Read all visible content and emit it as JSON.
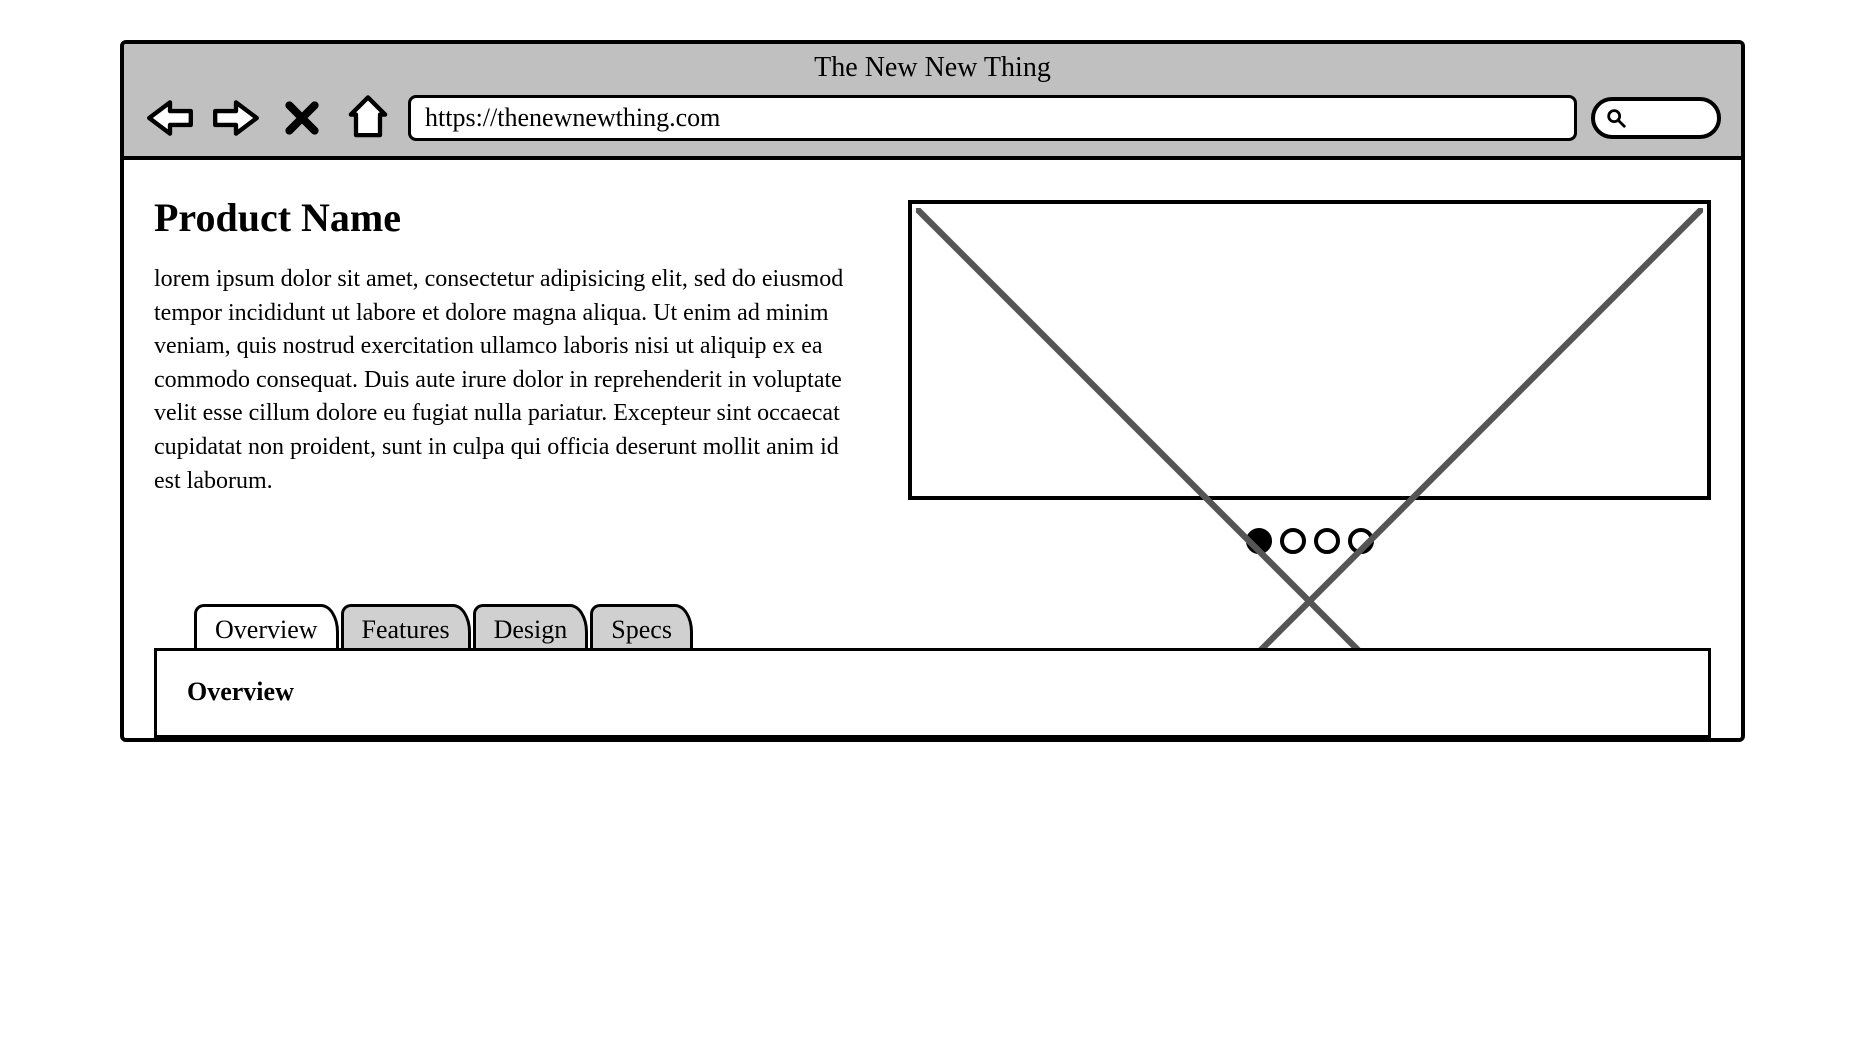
{
  "browser": {
    "title": "The New New Thing",
    "url": "https://thenewnewthing.com"
  },
  "product": {
    "name": "Product Name",
    "description": "lorem ipsum dolor sit amet, consectetur adipisicing elit, sed do eiusmod tempor incididunt ut labore et dolore magna aliqua. Ut enim ad minim veniam, quis nostrud exercitation ullamco laboris nisi ut aliquip ex ea commodo consequat. Duis aute irure dolor in reprehenderit in voluptate velit esse cillum dolore eu fugiat nulla pariatur. Excepteur sint occaecat cupidatat non proident, sunt in culpa qui officia deserunt mollit anim id est laborum."
  },
  "carousel": {
    "dot_count": 4,
    "active_index": 0
  },
  "tabs": {
    "items": [
      "Overview",
      "Features",
      "Design",
      "Specs"
    ],
    "active_index": 0,
    "panel_heading": "Overview"
  }
}
